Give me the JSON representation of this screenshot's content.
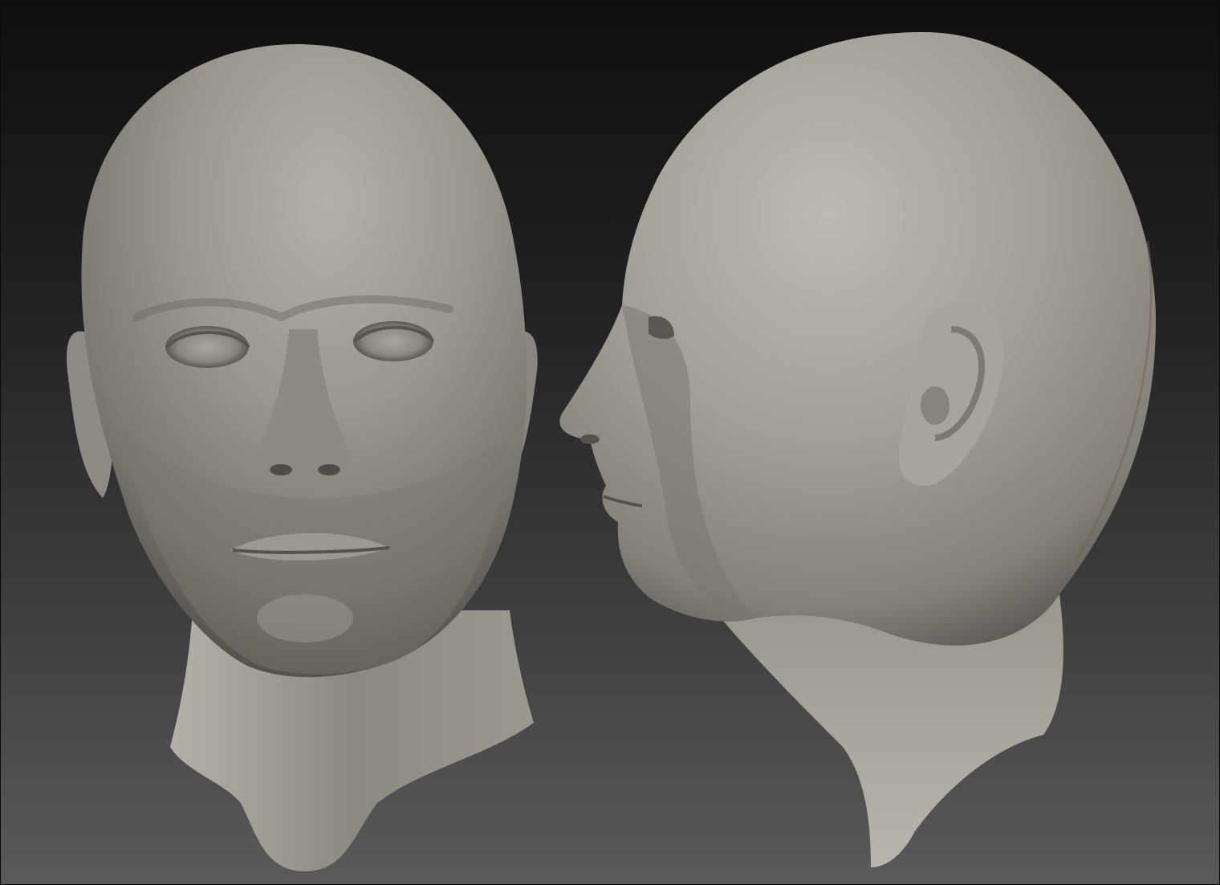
{
  "scene": {
    "background_top": "#0f0f0f",
    "background_bottom": "#5a5a5a",
    "material_light": "#a9a69e",
    "material_mid": "#8a867e",
    "material_dark": "#4a4743",
    "rim_tint": "#7a5a4c"
  },
  "models": [
    {
      "name": "head-front-view",
      "view": "front"
    },
    {
      "name": "head-side-view",
      "view": "side-profile-facing-left"
    }
  ]
}
